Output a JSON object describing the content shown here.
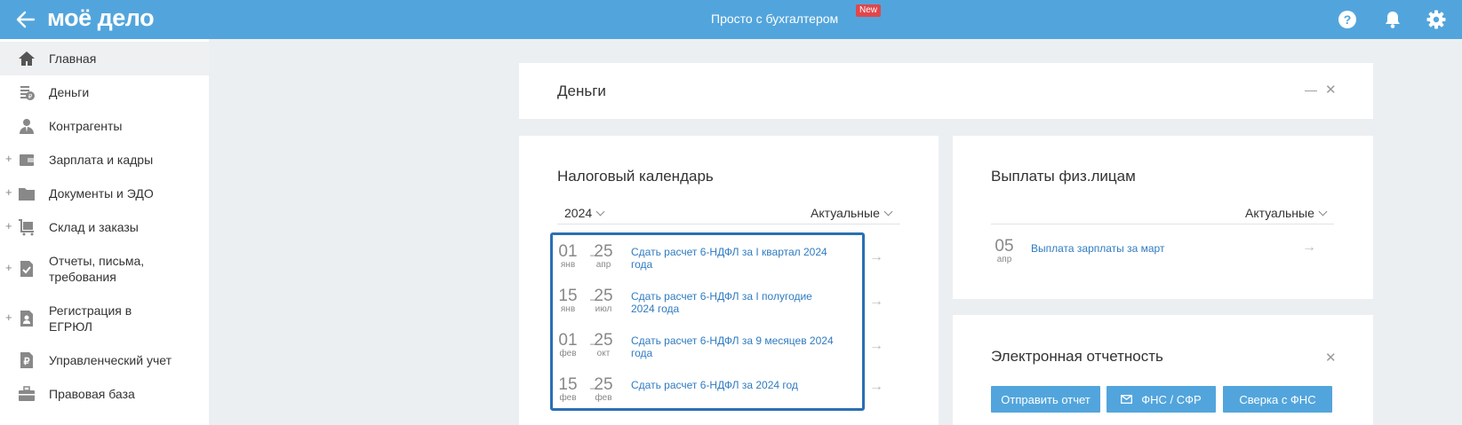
{
  "header": {
    "logo": "моё дело",
    "center_title": "Просто с бухгалтером",
    "new_badge": "New",
    "icons": [
      "back-arrow-icon",
      "help-icon",
      "bell-icon",
      "gear-icon"
    ]
  },
  "sidebar": {
    "items": [
      {
        "label": "Главная",
        "icon": "home-icon",
        "expandable": false,
        "active": true
      },
      {
        "label": "Деньги",
        "icon": "money-icon",
        "expandable": false
      },
      {
        "label": "Контрагенты",
        "icon": "contractor-icon",
        "expandable": false
      },
      {
        "label": "Зарплата и кадры",
        "icon": "wallet-icon",
        "expandable": true
      },
      {
        "label": "Документы и ЭДО",
        "icon": "folder-icon",
        "expandable": true
      },
      {
        "label": "Склад и заказы",
        "icon": "cart-icon",
        "expandable": true
      },
      {
        "label": "Отчеты, письма,",
        "label2": "требования",
        "icon": "report-icon",
        "expandable": true
      },
      {
        "label": "Регистрация в",
        "label2": "ЕГРЮЛ",
        "icon": "registration-icon",
        "expandable": true
      },
      {
        "label": "Управленческий учет",
        "icon": "ruble-doc-icon",
        "expandable": false
      },
      {
        "label": "Правовая база",
        "icon": "briefcase-icon",
        "expandable": false
      }
    ]
  },
  "money_card": {
    "title": "Деньги",
    "minimize": "—",
    "close": "✕"
  },
  "tax_calendar": {
    "title": "Налоговый календарь",
    "year": "2024",
    "filter": "Актуальные",
    "rows": [
      {
        "from_day": "01",
        "from_month": "янв",
        "to_day": "25",
        "to_month": "апр",
        "text1": "Сдать расчет 6-НДФЛ за I квартал 2024",
        "text2": "года"
      },
      {
        "from_day": "15",
        "from_month": "янв",
        "to_day": "25",
        "to_month": "июл",
        "text1": "Сдать расчет 6-НДФЛ за I полугодие",
        "text2": "2024 года"
      },
      {
        "from_day": "01",
        "from_month": "фев",
        "to_day": "25",
        "to_month": "окт",
        "text1": "Сдать расчет 6-НДФЛ за 9 месяцев 2024",
        "text2": "года"
      },
      {
        "from_day": "15",
        "from_month": "фев",
        "to_day": "25",
        "to_month": "фев",
        "text1": "Сдать расчет 6-НДФЛ за 2024 год",
        "text2": ""
      }
    ],
    "dash": "–",
    "arrow": "→"
  },
  "payments": {
    "title": "Выплаты физ.лицам",
    "filter": "Актуальные",
    "rows": [
      {
        "day": "05",
        "month": "апр",
        "text": "Выплата зарплаты за март"
      }
    ],
    "arrow": "→"
  },
  "ereporting": {
    "title": "Электронная отчетность",
    "close": "✕",
    "buttons": {
      "send": "Отправить отчет",
      "fns": "ФНС / СФР",
      "reconcile": "Сверка с ФНС"
    }
  },
  "colors": {
    "header_bg": "#52a5dc",
    "link": "#2f7bc1",
    "button_bg": "#52a5dc",
    "badge": "#e0474c",
    "highlight_border": "#2a6fb4"
  }
}
